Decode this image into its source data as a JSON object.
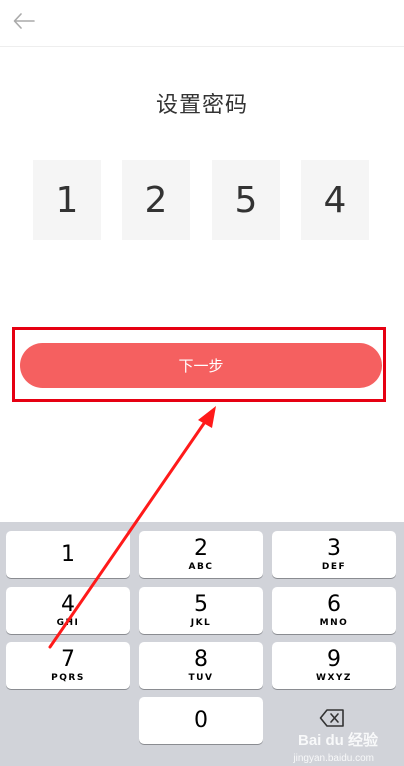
{
  "header": {
    "back_icon": "arrow-left-icon"
  },
  "page": {
    "title": "设置密码"
  },
  "pin": {
    "digits": [
      "1",
      "2",
      "5",
      "4"
    ]
  },
  "actions": {
    "next_label": "下一步"
  },
  "keyboard": {
    "keys": [
      {
        "number": "1",
        "letters": ""
      },
      {
        "number": "2",
        "letters": "ABC"
      },
      {
        "number": "3",
        "letters": "DEF"
      },
      {
        "number": "4",
        "letters": "GHI"
      },
      {
        "number": "5",
        "letters": "JKL"
      },
      {
        "number": "6",
        "letters": "MNO"
      },
      {
        "number": "7",
        "letters": "PQRS"
      },
      {
        "number": "8",
        "letters": "TUV"
      },
      {
        "number": "9",
        "letters": "WXYZ"
      },
      {
        "number": "0",
        "letters": ""
      }
    ],
    "delete_icon": "backspace-icon"
  },
  "watermark": {
    "brand": "Bai du 经验",
    "url": "jingyan.baidu.com"
  },
  "colors": {
    "accent": "#f56060",
    "highlight": "#e60012",
    "keyboard_bg": "#d1d3d9",
    "digit_box_bg": "#f5f5f5"
  }
}
